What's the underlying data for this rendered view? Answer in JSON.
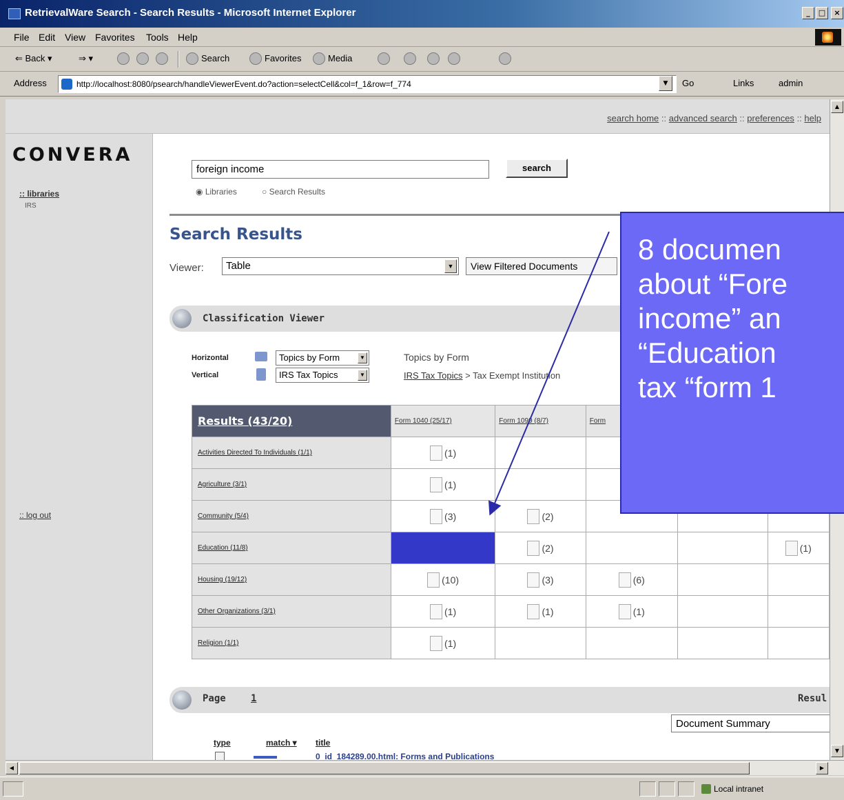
{
  "window": {
    "title": "RetrievalWare Search - Search Results - Microsoft Internet Explorer",
    "min_glyph": "_",
    "max_glyph": "□",
    "close_glyph": "×"
  },
  "menu": [
    "File",
    "Edit",
    "View",
    "Favorites",
    "Tools",
    "Help"
  ],
  "toolbar": {
    "back": "⇐ Back ▾",
    "forward": "⇒ ▾",
    "search": "Search",
    "favorites": "Favorites",
    "media": "Media"
  },
  "address": {
    "label": "Address",
    "url": "http://localhost:8080/psearch/handleViewerEvent.do?action=selectCell&col=f_1&row=f_774",
    "go": "Go",
    "links": "Links",
    "admin": "admin"
  },
  "page": {
    "top_links": {
      "search_home": "search home",
      "advanced": "advanced search",
      "preferences": "preferences",
      "help": "help",
      "sep": "::"
    },
    "logo": "CONVERA",
    "libraries": ":: libraries",
    "irs": "IRS",
    "logout": ":: log out",
    "query": "foreign income",
    "search_button": "search",
    "radio_libraries": "Libraries",
    "radio_results": "Search Results",
    "results_title": "Search Results",
    "viewer_label": "Viewer:",
    "viewer_value": "Table",
    "view_filtered": "View Filtered Documents",
    "classification_viewer": "Classification Viewer",
    "horizontal_label": "Horizontal",
    "vertical_label": "Vertical",
    "horizontal_value": "Topics by Form",
    "vertical_value": "IRS Tax Topics",
    "topics_by_form": "Topics by Form",
    "crumb_link": "IRS Tax Topics",
    "crumb_rest": "> Tax Exempt Institution",
    "results_header": "Results (43/20)",
    "columns": [
      "Form 1040 (25/17)",
      "Form 1099 (8/7)",
      "Form",
      "",
      ""
    ],
    "rows": [
      {
        "label": "Activities Directed To Individuals (1/1)",
        "cells": [
          "(1)",
          "",
          "",
          "",
          ""
        ]
      },
      {
        "label": "Agriculture (3/1)",
        "cells": [
          "(1)",
          "",
          "",
          "",
          ""
        ]
      },
      {
        "label": "Community (5/4)",
        "cells": [
          "(3)",
          "(2)",
          "",
          "",
          ""
        ]
      },
      {
        "label": "Education (11/8)",
        "cells": [
          "",
          "(2)",
          "",
          "",
          "(1)"
        ]
      },
      {
        "label": "Housing (19/12)",
        "cells": [
          "(10)",
          "(3)",
          "(6)",
          "",
          ""
        ]
      },
      {
        "label": "Other Organizations (3/1)",
        "cells": [
          "(1)",
          "(1)",
          "(1)",
          "",
          ""
        ]
      },
      {
        "label": "Religion (1/1)",
        "cells": [
          "(1)",
          "",
          "",
          "",
          ""
        ]
      }
    ],
    "page_label": "Page",
    "page_num": "1",
    "results_label": "Resul",
    "doc_summary": "Document Summary",
    "col_type": "type",
    "col_match": "match ▾",
    "col_title": "title",
    "cut_text": "0_id_184289.00.html: Forms and Publications"
  },
  "status": {
    "zone": "Local intranet"
  },
  "callout": {
    "lines": [
      "8 documen",
      "about “Fore",
      "income” an",
      "“Education",
      "tax “form 1"
    ],
    "color": "#6b69f5"
  },
  "highlight_color": "#3338c9"
}
